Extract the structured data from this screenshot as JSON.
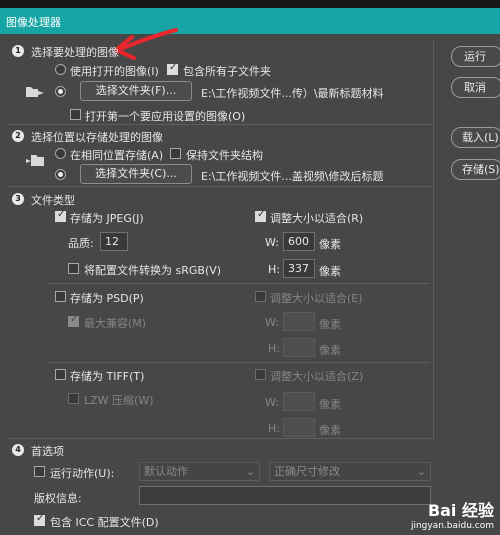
{
  "window": {
    "title": "图像处理器"
  },
  "sections": {
    "s1": {
      "number": "1",
      "title": "选择要处理的图像",
      "use_open": "使用打开的图像(I)",
      "include_sub": "包含所有子文件夹",
      "select_folder": "选择文件夹(F)...",
      "path": "E:\\工作视频文件...传）\\最新标题材料",
      "open_first": "打开第一个要应用设置的图像(O)"
    },
    "s2": {
      "number": "2",
      "title": "选择位置以存储处理的图像",
      "same_loc": "在相同位置存储(A)",
      "keep_struct": "保持文件夹结构",
      "select_folder": "选择文件夹(C)...",
      "path": "E:\\工作视频文件...盖视频\\修改后标题"
    },
    "s3": {
      "number": "3",
      "title": "文件类型",
      "jpeg": {
        "save": "存储为 JPEG(J)",
        "resize": "调整大小以适合(R)",
        "quality_label": "品质:",
        "quality": "12",
        "convert": "将配置文件转换为 sRGB(V)",
        "w_label": "W:",
        "w": "600",
        "h_label": "H:",
        "h": "337",
        "unit": "像素"
      },
      "psd": {
        "save": "存储为 PSD(P)",
        "resize": "调整大小以适合(E)",
        "max": "最大兼容(M)",
        "w_label": "W:",
        "h_label": "H:",
        "unit": "像素"
      },
      "tiff": {
        "save": "存储为 TIFF(T)",
        "resize": "调整大小以适合(Z)",
        "lzw": "LZW 压缩(W)",
        "w_label": "W:",
        "h_label": "H:",
        "unit": "像素"
      }
    },
    "s4": {
      "number": "4",
      "title": "首选项",
      "run_action": "运行动作(U):",
      "action_set": "默认动作",
      "action": "正确尺寸修改",
      "copyright_label": "版权信息:",
      "copyright": "",
      "icc": "包含 ICC 配置文件(D)"
    }
  },
  "buttons": {
    "run": "运行",
    "cancel": "取消",
    "load": "载入(L)...",
    "save": "存储(S)..."
  },
  "watermark": {
    "brand": "Bai 经验",
    "url": "jingyan.baidu.com"
  },
  "colors": {
    "titlebar": "#16a4a4",
    "panel": "#474747",
    "annotation_arrow": "#e8262c"
  }
}
